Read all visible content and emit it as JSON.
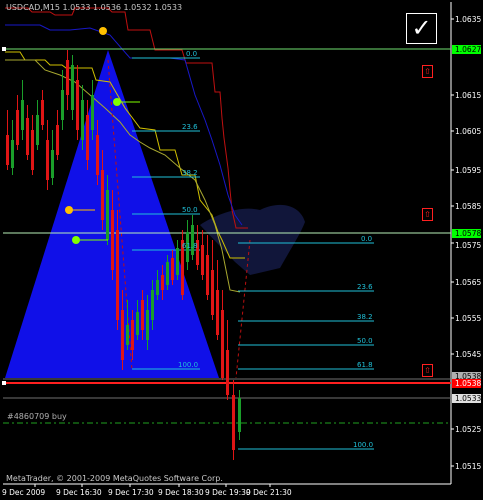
{
  "chart_title": "USDCAD,M15  1.0533 1.0536 1.0532 1.0533",
  "copyright": "MetaTrader, © 2001-2009 MetaQuotes Software Corp.",
  "order_label": "#4860709 buy",
  "check_mark": "✓",
  "arrow_glyph": "⇧",
  "colors": {
    "background": "#000000",
    "axis": "#ffffff",
    "bull_candle": "#1a9e2a",
    "bear_candle": "#e01515",
    "triangle": "#1010e8",
    "fib": "#20c0d8",
    "hline_green": "#70e070",
    "hline_red": "#ff2020",
    "ma_yellow": "#d0c000",
    "ma_red": "#c01010",
    "ma_blue": "#1010c0",
    "ma_khaki": "#a8a830",
    "dot_yellow": "#ffc000",
    "dot_green": "#80ff00",
    "price_tag_green_bg": "#00ff00",
    "price_tag_red_bg": "#ff0000"
  },
  "price_scale": [
    "1.0635",
    "1.0615",
    "1.0605",
    "1.0595",
    "1.0585",
    "1.0575",
    "1.0565",
    "1.0555",
    "1.0545",
    "1.0525",
    "1.0515"
  ],
  "price_tags": {
    "green_upper": "1.0627",
    "green_lower": "1.0578",
    "red": "1.0538",
    "gray_upper": "1.0538",
    "gray_current": "1.0533"
  },
  "time_scale": [
    "9 Dec 2009",
    "9 Dec 16:30",
    "9 Dec 17:30",
    "9 Dec 18:30",
    "9 Dec 19:30",
    "9 Dec 21:30"
  ],
  "fib_upper": [
    "0.0",
    "23.6",
    "38.2",
    "50.0",
    "61.8",
    "100.0"
  ],
  "fib_lower": [
    "0.0",
    "23.6",
    "38.2",
    "50.0",
    "61.8",
    "100.0"
  ]
}
